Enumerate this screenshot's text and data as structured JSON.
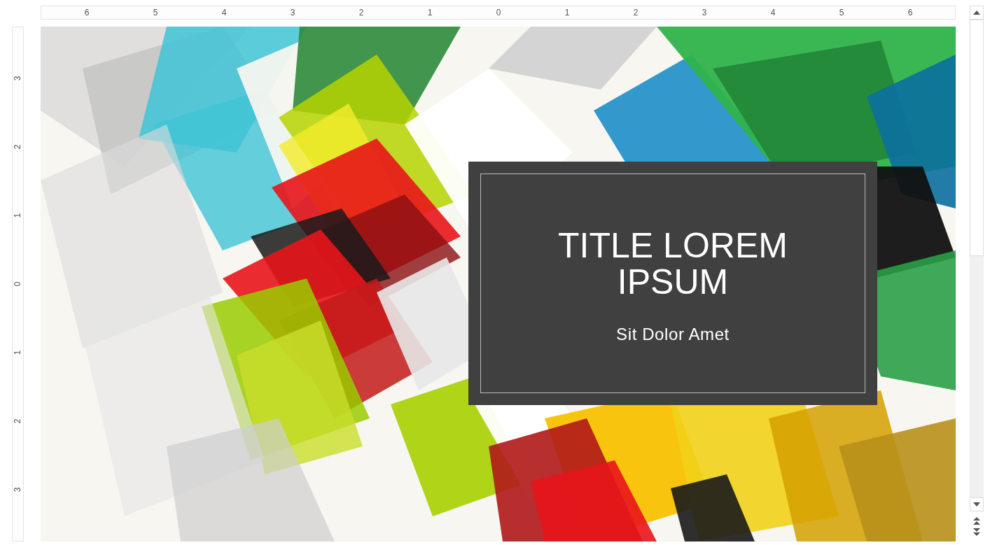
{
  "horizontal_ruler": {
    "labels": [
      "6",
      "5",
      "4",
      "3",
      "2",
      "1",
      "0",
      "1",
      "2",
      "3",
      "4",
      "5",
      "6"
    ]
  },
  "vertical_ruler": {
    "labels": [
      "3",
      "2",
      "1",
      "0",
      "1",
      "2",
      "3"
    ]
  },
  "slide": {
    "title": "TITLE LOREM IPSUM",
    "subtitle": "Sit Dolor Amet"
  }
}
